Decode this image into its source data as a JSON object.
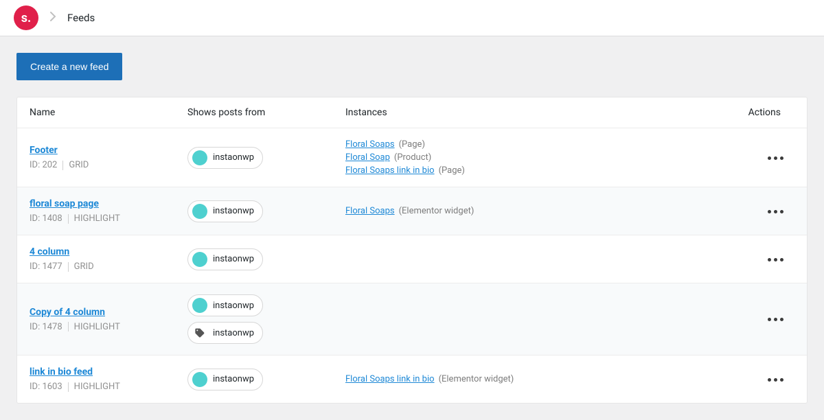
{
  "breadcrumb": {
    "logo_text": "s.",
    "title": "Feeds"
  },
  "buttons": {
    "create_feed": "Create a new feed"
  },
  "columns": {
    "name": "Name",
    "shows": "Shows posts from",
    "instances": "Instances",
    "actions": "Actions"
  },
  "labels": {
    "id_prefix": "ID: "
  },
  "feeds": [
    {
      "name": "Footer",
      "id": "202",
      "type": "GRID",
      "sources": [
        {
          "kind": "avatar",
          "label": "instaonwp"
        }
      ],
      "instances": [
        {
          "title": "Floral Soaps",
          "type": "(Page)"
        },
        {
          "title": "Floral Soap",
          "type": "(Product)"
        },
        {
          "title": "Floral Soaps link in bio",
          "type": "(Page)"
        }
      ]
    },
    {
      "name": "floral soap page",
      "id": "1408",
      "type": "HIGHLIGHT",
      "sources": [
        {
          "kind": "avatar",
          "label": "instaonwp"
        }
      ],
      "instances": [
        {
          "title": "Floral Soaps",
          "type": "(Elementor widget)"
        }
      ]
    },
    {
      "name": "4 column",
      "id": "1477",
      "type": "GRID",
      "sources": [
        {
          "kind": "avatar",
          "label": "instaonwp"
        }
      ],
      "instances": []
    },
    {
      "name": "Copy of 4 column",
      "id": "1478",
      "type": "HIGHLIGHT",
      "sources": [
        {
          "kind": "avatar",
          "label": "instaonwp"
        },
        {
          "kind": "tag",
          "label": "instaonwp"
        }
      ],
      "instances": []
    },
    {
      "name": "link in bio feed",
      "id": "1603",
      "type": "HIGHLIGHT",
      "sources": [
        {
          "kind": "avatar",
          "label": "instaonwp"
        }
      ],
      "instances": [
        {
          "title": "Floral Soaps link in bio",
          "type": "(Elementor widget)"
        }
      ]
    }
  ]
}
